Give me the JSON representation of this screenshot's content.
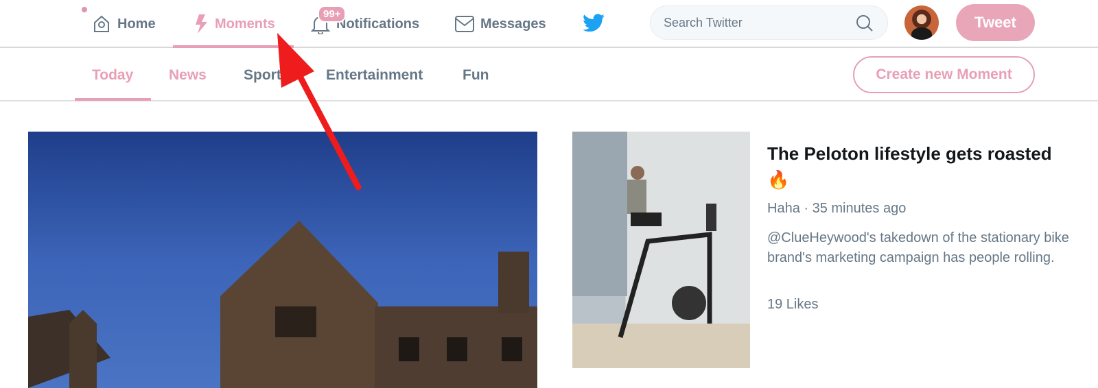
{
  "nav": {
    "items": [
      {
        "label": "Home",
        "icon": "home-icon"
      },
      {
        "label": "Moments",
        "icon": "lightning-icon",
        "active": true
      },
      {
        "label": "Notifications",
        "icon": "bell-icon",
        "badge": "99+"
      },
      {
        "label": "Messages",
        "icon": "envelope-icon"
      }
    ],
    "search_placeholder": "Search Twitter",
    "tweet_label": "Tweet"
  },
  "tabs": [
    "Today",
    "News",
    "Sports",
    "Entertainment",
    "Fun"
  ],
  "create_label": "Create new Moment",
  "story": {
    "title": "The Peloton lifestyle gets roasted 🔥",
    "meta": "Haha · 35 minutes ago",
    "description": "@ClueHeywood's takedown of the stationary bike brand's marketing campaign has people rolling.",
    "likes": "19 Likes"
  },
  "colors": {
    "accent": "#e89fb5",
    "text_muted": "#657786",
    "twitter_blue": "#1da1f2",
    "annotation_arrow": "#ee1c1c"
  }
}
